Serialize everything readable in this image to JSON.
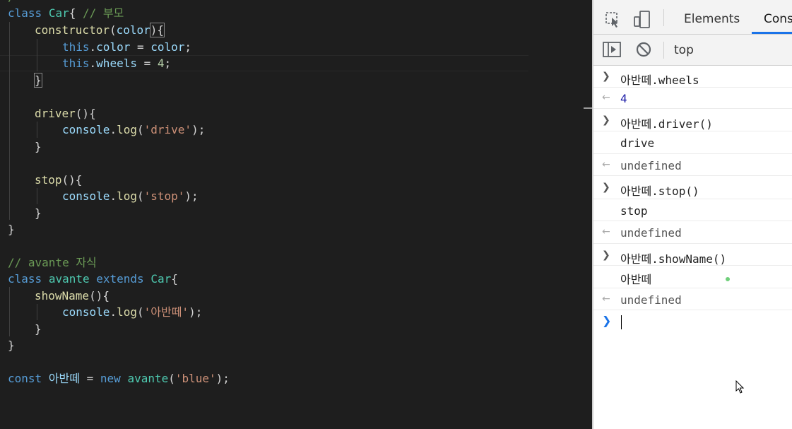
{
  "code": {
    "l0": {
      "kw": "class",
      "cls": "Car",
      "brace": "{",
      "cmt": " // 부모"
    },
    "l1": {
      "fn": "constructor",
      "open": "(",
      "var": "color",
      "close": "){"
    },
    "l2": {
      "kw": "this",
      "dot": ".",
      "prop": "color",
      "eq": " = ",
      "var": "color",
      "semi": ";"
    },
    "l3": {
      "kw": "this",
      "dot": ".",
      "prop": "wheels",
      "eq": " = ",
      "num": "4",
      "semi": ";"
    },
    "l4": {
      "brace": "}"
    },
    "l6": {
      "fn": "driver",
      "rest": "(){"
    },
    "l7": {
      "obj": "console",
      "dot": ".",
      "fn": "log",
      "open": "(",
      "str": "'drive'",
      "close": ");"
    },
    "l8": {
      "brace": "}"
    },
    "l10": {
      "fn": "stop",
      "rest": "(){"
    },
    "l11": {
      "obj": "console",
      "dot": ".",
      "fn": "log",
      "open": "(",
      "str": "'stop'",
      "close": ");"
    },
    "l12": {
      "brace": "}"
    },
    "l13": {
      "brace": "}"
    },
    "l15": {
      "cmt": "// avante 자식"
    },
    "l16": {
      "kw": "class",
      "cls": "avante",
      "kw2": "extends",
      "cls2": "Car",
      "brace": "{"
    },
    "l17": {
      "fn": "showName",
      "rest": "(){"
    },
    "l18": {
      "obj": "console",
      "dot": ".",
      "fn": "log",
      "open": "(",
      "str": "'아반떼'",
      "close": ");"
    },
    "l19": {
      "brace": "}"
    },
    "l20": {
      "brace": "}"
    },
    "l22": {
      "kw": "const",
      "var": "아반떼",
      "eq": " = ",
      "kw2": "new",
      "cls": "avante",
      "open": "(",
      "str": "'blue'",
      "close": ");"
    }
  },
  "devtools": {
    "tabs": {
      "elements": "Elements",
      "console": "Cons"
    },
    "context": "top",
    "rows": [
      {
        "kind": "input",
        "text": "아반떼.wheels"
      },
      {
        "kind": "return",
        "text": "4",
        "style": "blue"
      },
      {
        "kind": "input",
        "text": "아반떼.driver()"
      },
      {
        "kind": "log",
        "text": "drive"
      },
      {
        "kind": "return",
        "text": "undefined",
        "style": "grey"
      },
      {
        "kind": "input",
        "text": "아반떼.stop()"
      },
      {
        "kind": "log",
        "text": "stop"
      },
      {
        "kind": "return",
        "text": "undefined",
        "style": "grey"
      },
      {
        "kind": "input",
        "text": "아반떼.showName()"
      },
      {
        "kind": "log",
        "text": "아반떼"
      },
      {
        "kind": "return",
        "text": "undefined",
        "style": "grey"
      }
    ]
  },
  "colors": {
    "accent": "#1a73e8",
    "editor_bg": "#1e1e1e",
    "keyword": "#569cd6",
    "class": "#4ec9b0",
    "function": "#dcdcaa",
    "string": "#ce9178",
    "number": "#b5cea8",
    "comment": "#6a9955",
    "variable": "#9cdcfe"
  },
  "icons": [
    "inspect-element-icon",
    "device-toolbar-icon",
    "show-sidebar-icon",
    "clear-console-icon",
    "prompt-chevron-icon",
    "mouse-cursor-icon"
  ]
}
